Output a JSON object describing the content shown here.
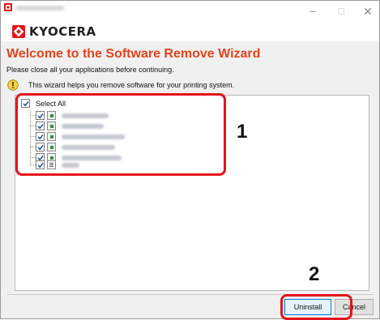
{
  "window": {
    "minimize_glyph": "–",
    "maximize_glyph": "□",
    "close_glyph": "✕"
  },
  "brand": {
    "logo_text": "KYOCERA",
    "accent_color": "#e2441b",
    "logo_color": "#e5141a"
  },
  "wizard": {
    "heading": "Welcome to the Software Remove Wizard",
    "instruction": "Please close all your applications before continuing.",
    "info_text": "This wizard helps you remove software for your printing system."
  },
  "software_list": {
    "select_all_label": "Select All",
    "select_all_checked": true,
    "items": [
      {
        "checked": true,
        "icon": "app-icon"
      },
      {
        "checked": true,
        "icon": "app-icon"
      },
      {
        "checked": true,
        "icon": "app-icon"
      },
      {
        "checked": true,
        "icon": "app-icon"
      },
      {
        "checked": true,
        "icon": "app-icon"
      },
      {
        "checked": true,
        "icon": "document-icon"
      }
    ]
  },
  "annotations": {
    "step1": "1",
    "step2": "2",
    "highlight_color": "#e5141a"
  },
  "buttons": {
    "uninstall_label": "Uninstall",
    "cancel_label": "Cancel"
  }
}
